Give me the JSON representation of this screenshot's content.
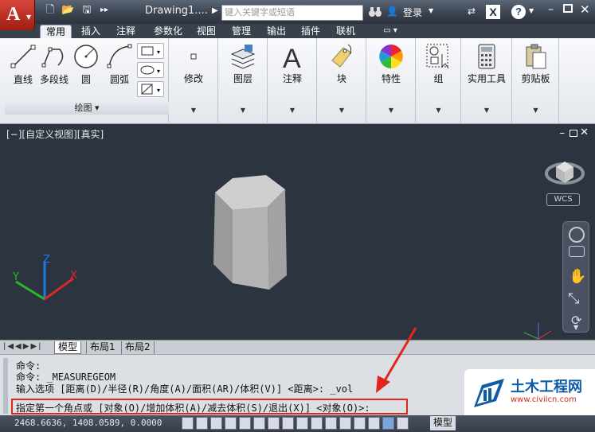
{
  "window": {
    "doc_title": "Drawing1....",
    "search_placeholder": "键入关键字或短语",
    "login": "登录"
  },
  "tabs": [
    "常用",
    "插入",
    "注释",
    "参数化",
    "视图",
    "管理",
    "输出",
    "插件",
    "联机"
  ],
  "active_tab": "常用",
  "draw_panel": {
    "tools": [
      "直线",
      "多段线",
      "圆",
      "圆弧"
    ],
    "footer": "绘图 ▾"
  },
  "panels": [
    "修改",
    "图层",
    "注释",
    "块",
    "特性",
    "组",
    "实用工具",
    "剪贴板"
  ],
  "viewport": {
    "label": "[−][自定义视图][真实]",
    "wcs": "WCS",
    "axis_labels": {
      "z": "Z",
      "y": "Y",
      "x": "X"
    }
  },
  "layout_tabs": [
    "模型",
    "布局1",
    "布局2"
  ],
  "command": {
    "lines": [
      "命令:",
      "命令: _MEASUREGEOM",
      "输入选项 [距离(D)/半径(R)/角度(A)/面积(AR)/体积(V)] <距离>: _vol"
    ],
    "prompt": "指定第一个角点或 [对象(O)/增加体积(A)/减去体积(S)/退出(X)] <对象(O)>:"
  },
  "status": {
    "coords": "2468.6636, 1408.0589, 0.0000",
    "model": "模型"
  },
  "watermark": {
    "title": "土木工程网",
    "url": "www.civilcn.com"
  },
  "colors": {
    "app_red": "#c8281c",
    "highlight_red": "#e2261c",
    "viewport_bg": "#2c3440"
  }
}
